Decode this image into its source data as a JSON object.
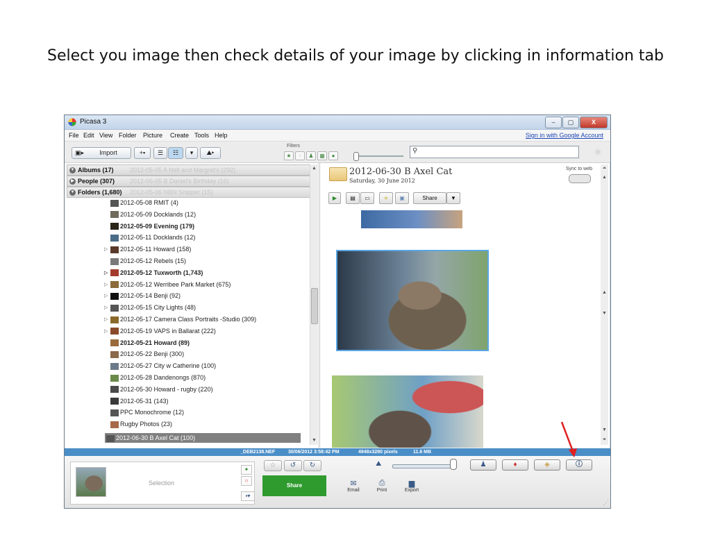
{
  "slide": {
    "title": "Select you image then check details of your image by clicking in information tab"
  },
  "window": {
    "title": "Picasa 3",
    "minimize": "–",
    "maximize": "▢",
    "close": "X"
  },
  "menu": [
    "File",
    "Edit",
    "View",
    "Folder",
    "Picture",
    "Create",
    "Tools",
    "Help"
  ],
  "signin": "Sign in with Google Account",
  "toolbar": {
    "import_label": "Import",
    "filters_label": "Filters"
  },
  "sidebar": {
    "sections": [
      {
        "label": "Albums (17)",
        "ghost": "2012-05-05 A Nell and Margret's (292)"
      },
      {
        "label": "People (307)",
        "ghost": "2012-05-05 B Daniel's Birthday (16)"
      },
      {
        "label": "Folders (1,680)",
        "ghost": "2012-05-06 NBN Snipper (15)"
      }
    ],
    "folders": [
      {
        "label": "2012-05-08 RMIT (4)",
        "bold": false,
        "expand": false,
        "color": "#555"
      },
      {
        "label": "2012-05-09 Docklands (12)",
        "bold": false,
        "expand": false,
        "color": "#6f6a5c"
      },
      {
        "label": "2012-05-09 Evening (179)",
        "bold": true,
        "expand": false,
        "color": "#2b2418"
      },
      {
        "label": "2012-05-11 Docklands (12)",
        "bold": false,
        "expand": false,
        "color": "#4b6c87"
      },
      {
        "label": "2012-05-11 Howard (158)",
        "bold": false,
        "expand": true,
        "color": "#5a3a2a"
      },
      {
        "label": "2012-05-12 Rebels (15)",
        "bold": false,
        "expand": false,
        "color": "#7a7a7a"
      },
      {
        "label": "2012-05-12 Tuxworth (1,743)",
        "bold": true,
        "expand": true,
        "color": "#a33b2c"
      },
      {
        "label": "2012-05-12 Werribee Park Market (675)",
        "bold": false,
        "expand": true,
        "color": "#8c6a3a"
      },
      {
        "label": "2012-05-14 Benji (92)",
        "bold": false,
        "expand": true,
        "color": "#111"
      },
      {
        "label": "2012-05-15 City Lights (48)",
        "bold": false,
        "expand": true,
        "color": "#555"
      },
      {
        "label": "2012-05-17 Camera Class Portraits -Studio (309)",
        "bold": false,
        "expand": true,
        "color": "#8a6a2a"
      },
      {
        "label": "2012-05-19 VAPS in Ballarat (222)",
        "bold": false,
        "expand": true,
        "color": "#8a4a2a"
      },
      {
        "label": "2012-05-21 Howard (89)",
        "bold": true,
        "expand": false,
        "color": "#9a6a3a"
      },
      {
        "label": "2012-05-22 Benji (300)",
        "bold": false,
        "expand": false,
        "color": "#8a6a4a"
      },
      {
        "label": "2012-05-27 City w Catherine (100)",
        "bold": false,
        "expand": false,
        "color": "#6a7a8a"
      },
      {
        "label": "2012-05-28 Dandenongs (870)",
        "bold": false,
        "expand": false,
        "color": "#6a8a4a"
      },
      {
        "label": "2012-05-30 Howard - rugby (220)",
        "bold": false,
        "expand": false,
        "color": "#4a4a4a"
      },
      {
        "label": "2012-05-31 (143)",
        "bold": false,
        "expand": false,
        "color": "#3a3a3a"
      },
      {
        "label": "PPC Monochrome (12)",
        "bold": false,
        "expand": false,
        "color": "#555"
      },
      {
        "label": "Rugby Photos (23)",
        "bold": false,
        "expand": false,
        "color": "#a66a4a"
      }
    ],
    "selected": "2012-06-30 B Axel Cat (100)"
  },
  "album": {
    "title": "2012-06-30 B Axel Cat",
    "date": "Saturday, 30 June 2012",
    "sync_label": "Sync to web",
    "share_label": "Share"
  },
  "status": {
    "filename": "_DEB2138.NEF",
    "datetime": "30/06/2012 3:58:42 PM",
    "dimensions": "4948x3280 pixels",
    "filesize": "11.6 MB"
  },
  "bottom": {
    "selection_label": "Selection",
    "share_label": "Share",
    "email_label": "Email",
    "print_label": "Print",
    "export_label": "Export"
  },
  "colors": {
    "status_bar": "#4a8ec8",
    "share_green": "#2f9b2f",
    "arrow_red": "#e02020",
    "selected_border": "#59a6e6"
  }
}
